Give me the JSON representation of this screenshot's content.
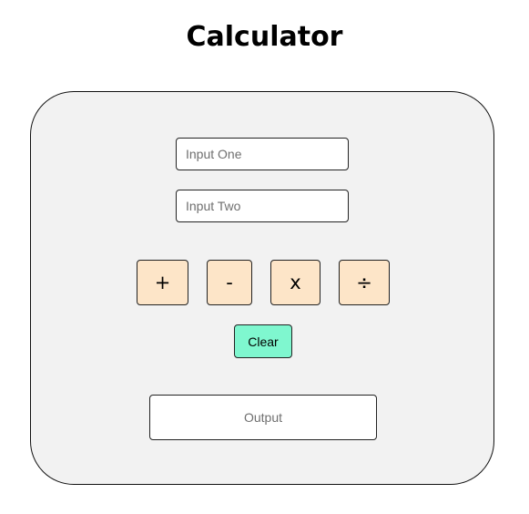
{
  "header": {
    "title": "Calculator"
  },
  "inputs": {
    "input_one": {
      "value": "",
      "placeholder": "Input One"
    },
    "input_two": {
      "value": "",
      "placeholder": "Input Two"
    }
  },
  "operators": {
    "add": "+",
    "subtract": "-",
    "multiply": "x",
    "divide": "÷"
  },
  "actions": {
    "clear_label": "Clear"
  },
  "output": {
    "text": "Output"
  },
  "colors": {
    "card_background": "#f2f2f2",
    "operator_button": "#fde5c8",
    "clear_button": "#7ff7cf",
    "border": "#222222"
  }
}
